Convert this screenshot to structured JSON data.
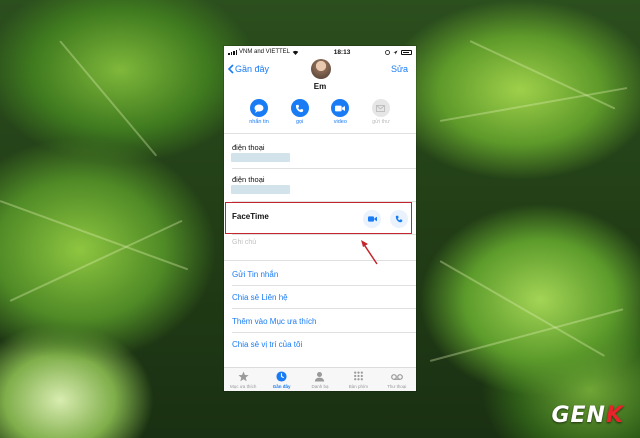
{
  "status_bar": {
    "carrier": "VNM and VIETTEL",
    "time": "18:13"
  },
  "nav": {
    "back_label": "Gần đây",
    "edit_label": "Sửa"
  },
  "contact": {
    "name": "Em"
  },
  "actions": [
    {
      "label": "nhắn tin",
      "icon": "message-icon",
      "enabled": true
    },
    {
      "label": "gọi",
      "icon": "phone-icon",
      "enabled": true
    },
    {
      "label": "video",
      "icon": "video-icon",
      "enabled": true
    },
    {
      "label": "gửi thư",
      "icon": "mail-icon",
      "enabled": false
    }
  ],
  "fields": [
    {
      "label": "điện thoại"
    },
    {
      "label": "điện thoại"
    }
  ],
  "facetime": {
    "label": "FaceTime"
  },
  "notes": {
    "placeholder": "Ghi chú"
  },
  "links": [
    {
      "label": "Gửi Tin nhắn"
    },
    {
      "label": "Chia sẻ Liên hệ"
    },
    {
      "label": "Thêm vào Mục ưa thích"
    },
    {
      "label": "Chia sẻ vị trí của tôi"
    }
  ],
  "tabs": [
    {
      "label": "Mục ưa thích",
      "icon": "star-icon",
      "active": false
    },
    {
      "label": "Gần đây",
      "icon": "clock-icon",
      "active": true
    },
    {
      "label": "Danh bạ",
      "icon": "contacts-icon",
      "active": false
    },
    {
      "label": "Bàn phím",
      "icon": "keypad-icon",
      "active": false
    },
    {
      "label": "Thư thoại",
      "icon": "voicemail-icon",
      "active": false
    }
  ],
  "watermark": {
    "text_main": "GEN",
    "text_accent": "K"
  },
  "colors": {
    "accent": "#1a7cf5",
    "highlight": "#c3262d"
  }
}
